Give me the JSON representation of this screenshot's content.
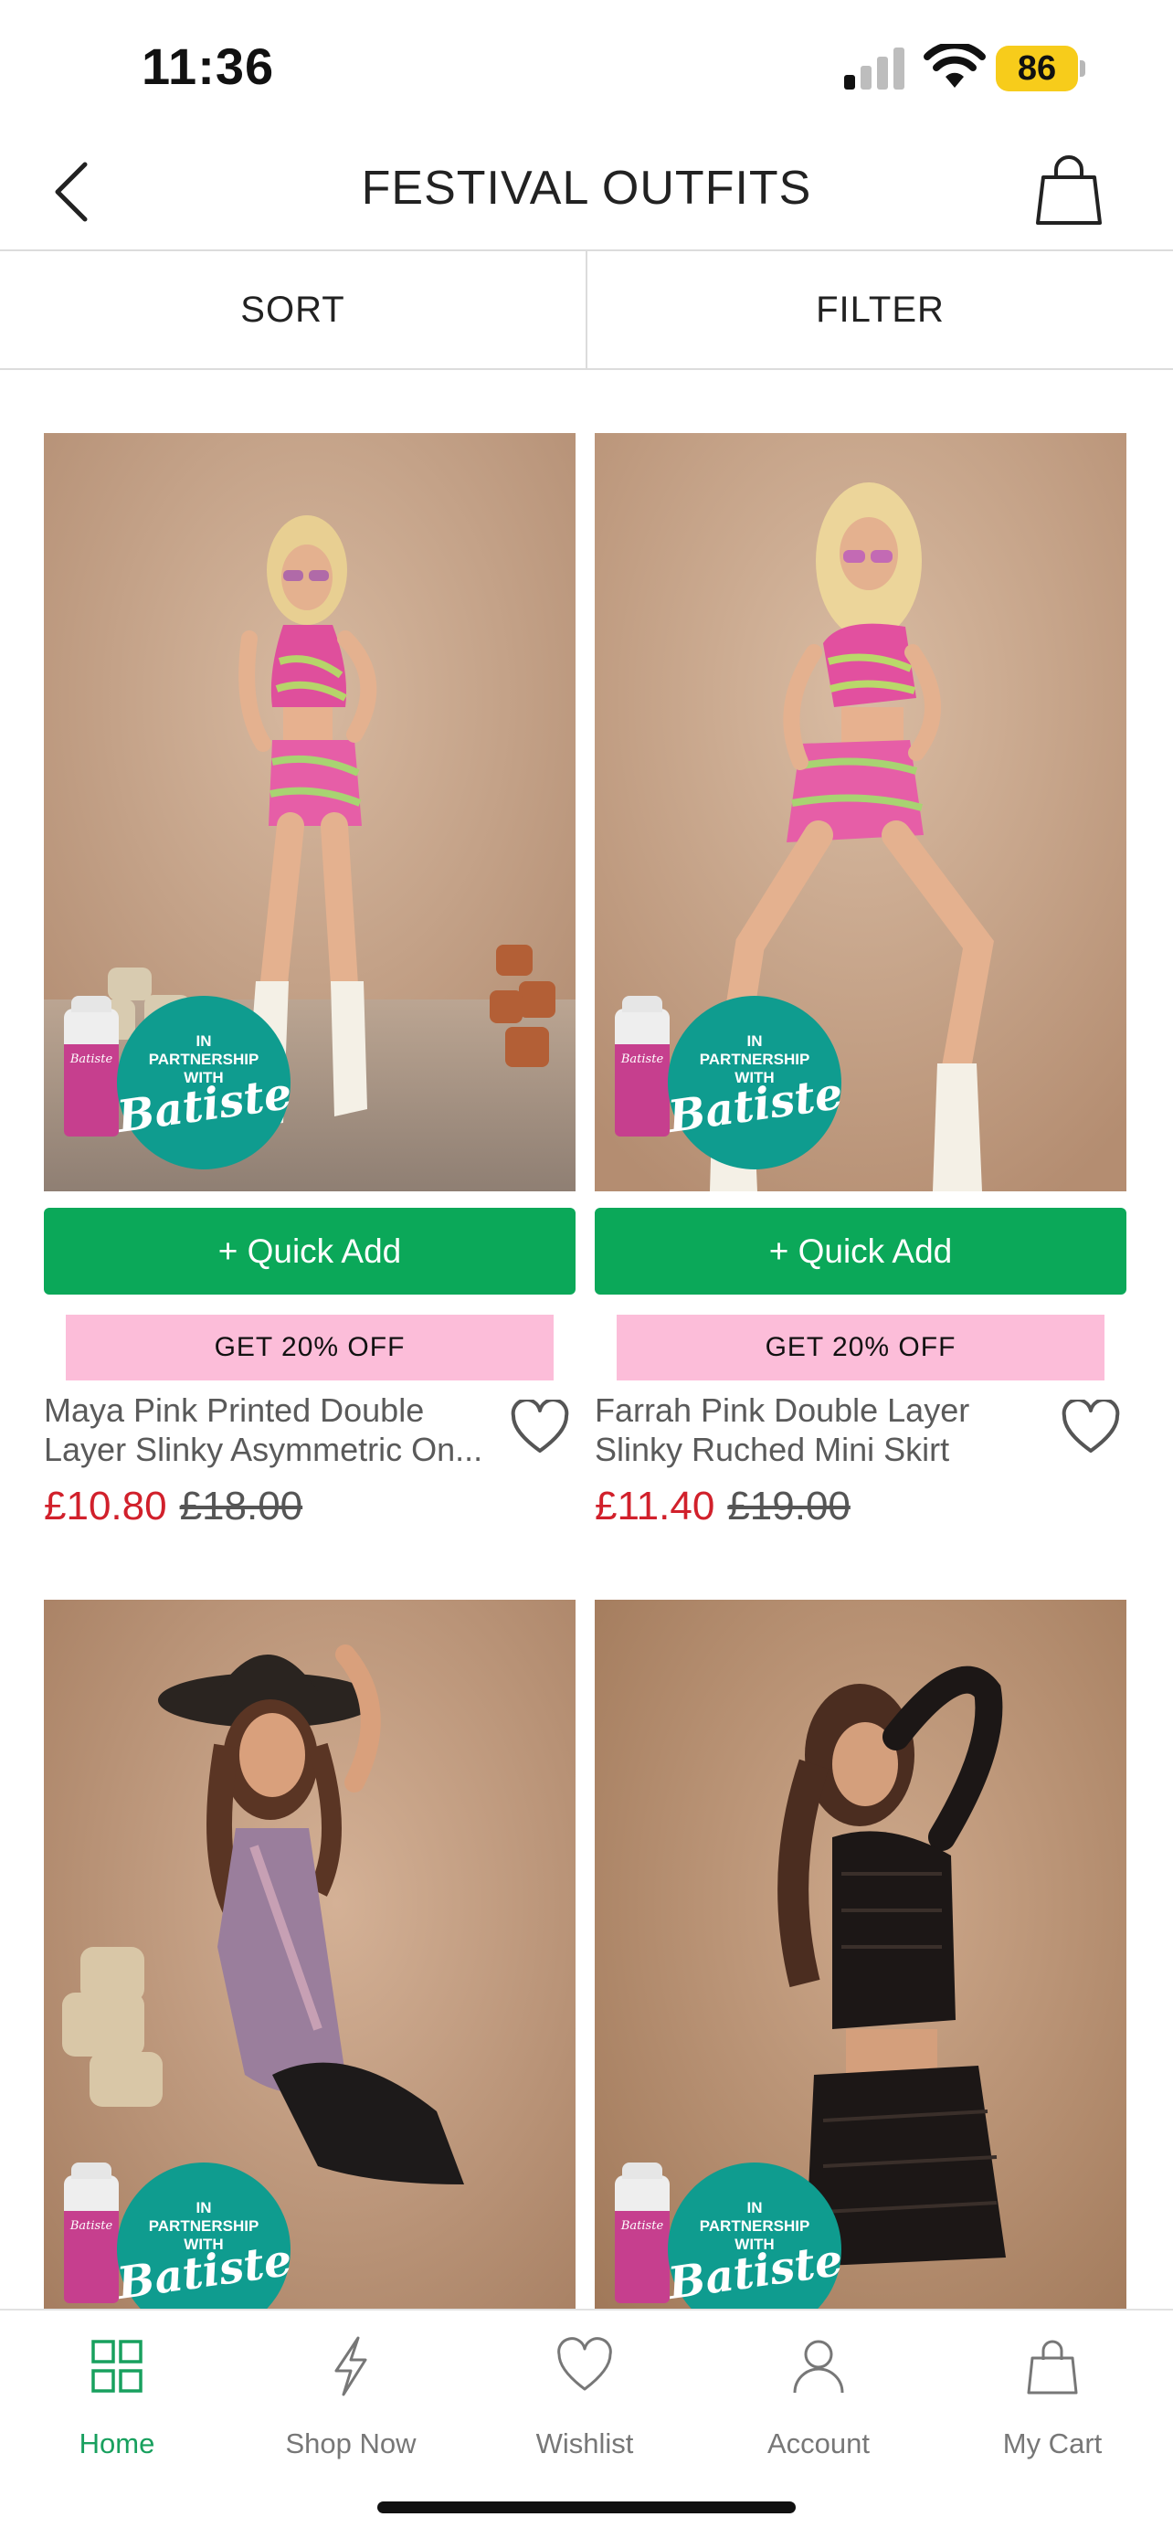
{
  "status": {
    "time": "11:36",
    "battery": "86"
  },
  "header": {
    "title": "FESTIVAL OUTFITS"
  },
  "toolbar": {
    "sort_label": "SORT",
    "filter_label": "FILTER"
  },
  "badge": {
    "line1": "IN",
    "line2": "PARTNERSHIP",
    "line3": "WITH",
    "brand": "Batiste",
    "spray_label": "Batiste"
  },
  "products": [
    {
      "quick_add": "+ Quick Add",
      "promo": "GET 20% OFF",
      "name_line1": "Maya Pink Printed Double",
      "name_line2": "Layer Slinky Asymmetric On...",
      "sale_price": "£10.80",
      "was_price": "£18.00"
    },
    {
      "quick_add": "+ Quick Add",
      "promo": "GET 20% OFF",
      "name_line1": "Farrah Pink Double Layer",
      "name_line2": "Slinky Ruched Mini Skirt",
      "sale_price": "£11.40",
      "was_price": "£19.00"
    }
  ],
  "nav": {
    "items": [
      {
        "label": "Home",
        "icon": "grid-icon",
        "active": true
      },
      {
        "label": "Shop Now",
        "icon": "lightning-icon"
      },
      {
        "label": "Wishlist",
        "icon": "heart-icon"
      },
      {
        "label": "Account",
        "icon": "user-icon"
      },
      {
        "label": "My Cart",
        "icon": "bag-icon"
      }
    ]
  },
  "colors": {
    "accent_green": "#0ba859",
    "sale_red": "#d1202b",
    "promo_pink": "#fcbdd9",
    "badge_teal": "#0f9c8f"
  }
}
